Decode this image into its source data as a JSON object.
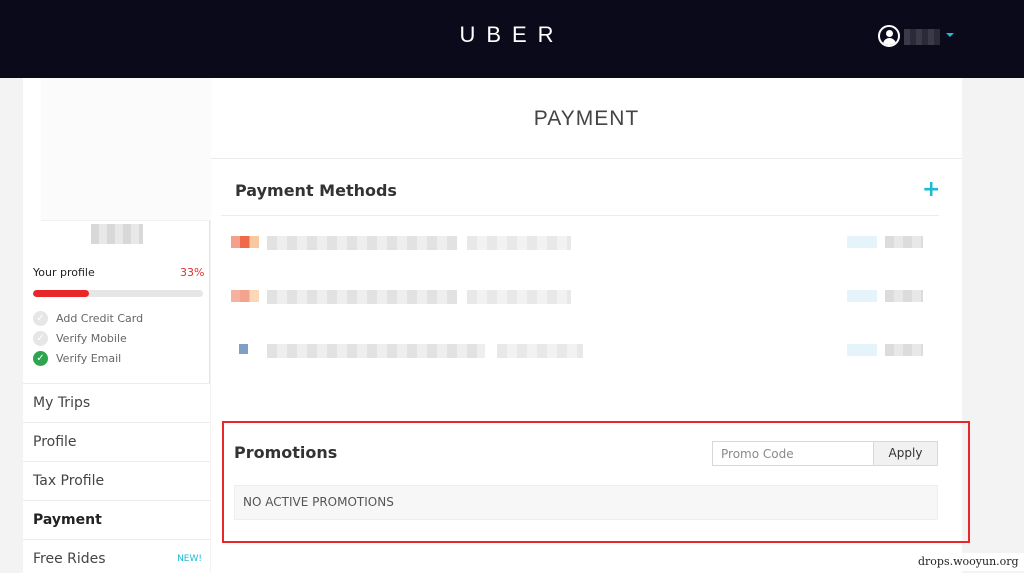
{
  "header": {
    "logo_text": "UBER"
  },
  "sidebar": {
    "profile_label": "Your profile",
    "profile_percent": "33%",
    "profile_progress": 0.33,
    "checklist": [
      {
        "label": "Add Credit Card",
        "done": false
      },
      {
        "label": "Verify Mobile",
        "done": false
      },
      {
        "label": "Verify Email",
        "done": true
      }
    ],
    "nav": [
      {
        "label": "My Trips"
      },
      {
        "label": "Profile"
      },
      {
        "label": "Tax Profile"
      },
      {
        "label": "Payment",
        "active": true
      },
      {
        "label": "Free Rides",
        "badge": "NEW!"
      }
    ]
  },
  "main": {
    "title": "PAYMENT",
    "payment_methods": {
      "title": "Payment Methods",
      "add_icon": "plus-icon"
    },
    "promotions": {
      "title": "Promotions",
      "promo_placeholder": "Promo Code",
      "apply_label": "Apply",
      "empty_text": "NO ACTIVE PROMOTIONS"
    }
  },
  "watermark": "drops.wooyun.org",
  "colors": {
    "header_bg": "#0a0a1a",
    "accent": "#1fbad6",
    "progress": "#e8272a",
    "verified": "#2ea44f",
    "highlight_border": "#e8272a"
  }
}
